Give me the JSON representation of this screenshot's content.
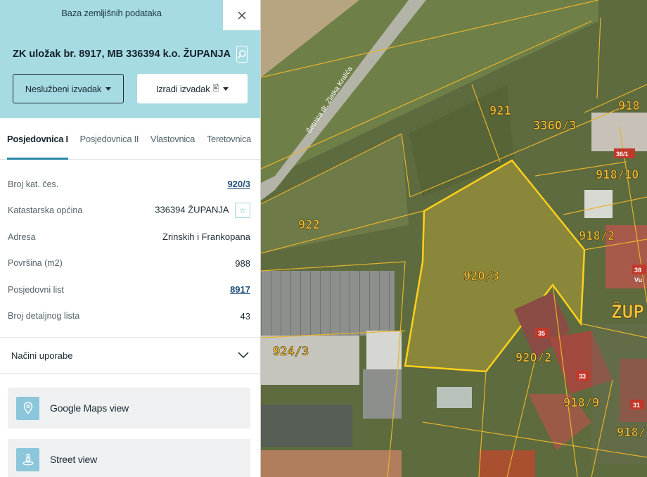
{
  "panel": {
    "app_title": "Baza zemljišnih podataka",
    "parcel_title": "ZK uložak br. 8917, MB 336394 k.o. ŽUPANJA",
    "buttons": {
      "unofficial_extract": "Neslužbeni izvadak",
      "create_extract": "Izradi izvadak"
    },
    "tabs": [
      "Posjedovnica I",
      "Posjedovnica II",
      "Vlastovnica",
      "Teretovnica"
    ],
    "active_tab": "Posjedovnica I",
    "properties": [
      {
        "key": "Broj kat. čes.",
        "value": "920/3"
      },
      {
        "key": "Katastarska općina",
        "value": "336394 ŽUPANJA"
      },
      {
        "key": "Adresa",
        "value": "Zrinskih i Frankopana"
      },
      {
        "key": "Površina (m2)",
        "value": "988"
      },
      {
        "key": "Posjedovni list",
        "value": "8917"
      },
      {
        "key": "Broj detaljnog lista",
        "value": "43"
      }
    ],
    "accordion_label": "Načini uporabe",
    "actions": [
      {
        "label": "Google Maps view",
        "icon": "map-pin-icon"
      },
      {
        "label": "Street view",
        "icon": "street-view-icon"
      }
    ],
    "colors": {
      "header_bg": "#a7dbe3",
      "accent": "#2b86a8",
      "link": "#1f4f7a"
    }
  },
  "map": {
    "street_name": "Šetnica dr. Zlatka Kralića",
    "parcel_labels": [
      "921",
      "3360/3",
      "918",
      "918/10",
      "922",
      "920/3",
      "918/2",
      "924/3",
      "920/2",
      "918/9",
      "918/"
    ],
    "place_label": "ŽUP",
    "house_numbers": [
      "36/1",
      "38",
      "35",
      "33",
      "31"
    ],
    "street_abbrev": "Vu",
    "selected_parcel": "920/3",
    "parcel_line_color": "#f1c232"
  }
}
